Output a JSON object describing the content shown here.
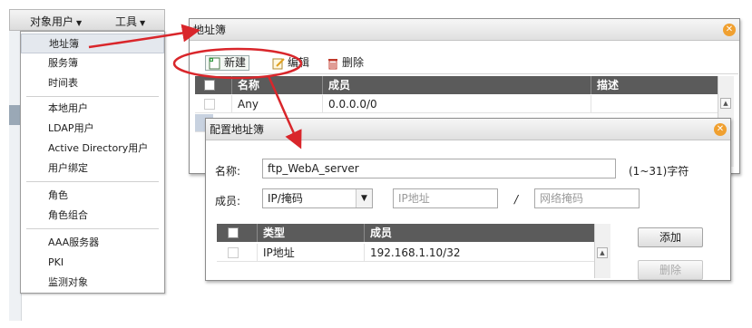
{
  "menubar": {
    "objects_label": "对象用户",
    "tools_label": "工具"
  },
  "dropdown": {
    "items": [
      {
        "label": "地址簿"
      },
      {
        "label": "服务簿"
      },
      {
        "label": "时间表"
      },
      {
        "label": "本地用户"
      },
      {
        "label": "LDAP用户"
      },
      {
        "label": "Active Directory用户"
      },
      {
        "label": "用户绑定"
      },
      {
        "label": "角色"
      },
      {
        "label": "角色组合"
      },
      {
        "label": "AAA服务器"
      },
      {
        "label": "PKI"
      },
      {
        "label": "监测对象"
      }
    ]
  },
  "address_book": {
    "title": "地址簿",
    "toolbar": {
      "new_label": "新建",
      "edit_label": "编辑",
      "delete_label": "删除"
    },
    "columns": {
      "name": "名称",
      "member": "成员",
      "desc": "描述"
    },
    "rows": [
      {
        "name": "Any",
        "member": "0.0.0.0/0",
        "desc": ""
      }
    ]
  },
  "config_dialog": {
    "title": "配置地址簿",
    "name_label": "名称:",
    "name_value": "ftp_WebA_server",
    "name_hint": "(1~31)字符",
    "member_label": "成员:",
    "member_type": "IP/掩码",
    "ip_placeholder": "IP地址",
    "slash": "/",
    "mask_placeholder": "网络掩码",
    "columns": {
      "type": "类型",
      "member": "成员"
    },
    "rows": [
      {
        "type": "IP地址",
        "member": "192.168.1.10/32"
      }
    ],
    "add_label": "添加",
    "delete_label": "删除"
  },
  "colors": {
    "annotation": "#d9262b",
    "header": "#5b5b5b",
    "close": "#f0a030"
  }
}
